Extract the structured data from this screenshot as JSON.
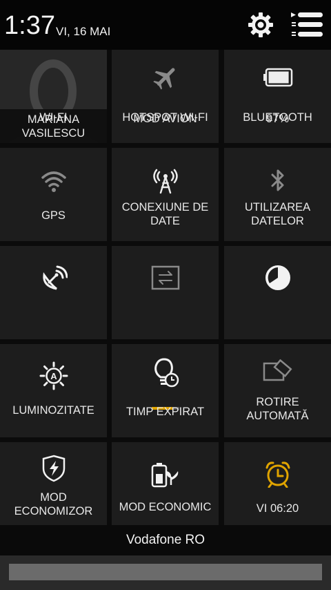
{
  "status": {
    "time": "1:37",
    "date": "VI, 16 MAI"
  },
  "tiles": {
    "user": {
      "label": "MARIANA VASILESCU"
    },
    "airplane": {
      "label": "MOD AVION"
    },
    "battery": {
      "label": "97%",
      "level": 0.97
    },
    "wifi": {
      "label": "WI-FI"
    },
    "hotspot": {
      "label": "HOTSPOT WI-FI"
    },
    "bluetooth": {
      "label": "BLUETOOTH"
    },
    "gps": {
      "label": "GPS"
    },
    "data_connection": {
      "label": "CONEXIUNE DE DATE"
    },
    "data_usage": {
      "label": "UTILIZAREA DATELOR"
    },
    "brightness": {
      "label": "LUMINOZITATE"
    },
    "screen_timeout": {
      "label": "TIMP EXPIRAT",
      "level": 0.75
    },
    "auto_rotate": {
      "label": "ROTIRE AUTOMATĂ"
    },
    "power_saver": {
      "label": "MOD ECONOMIZOR"
    },
    "eco_mode": {
      "label": "MOD ECONOMIC"
    },
    "alarm": {
      "label": "VI 06:20"
    }
  },
  "operator": {
    "name": "Vodafone RO"
  },
  "colors": {
    "accent": "#e0a400",
    "tile": "#1d1d1d",
    "icon_dim": "#8a8a8a",
    "icon_bright": "#f2f2f2"
  },
  "icons": [
    "settings-gear-icon",
    "notification-list-icon",
    "airplane-icon",
    "battery-icon",
    "wifi-icon",
    "hotspot-icon",
    "bluetooth-icon",
    "gps-icon",
    "data-connection-icon",
    "data-usage-icon",
    "brightness-icon",
    "screen-timeout-icon",
    "auto-rotate-icon",
    "power-saver-icon",
    "eco-mode-icon",
    "alarm-clock-icon"
  ]
}
